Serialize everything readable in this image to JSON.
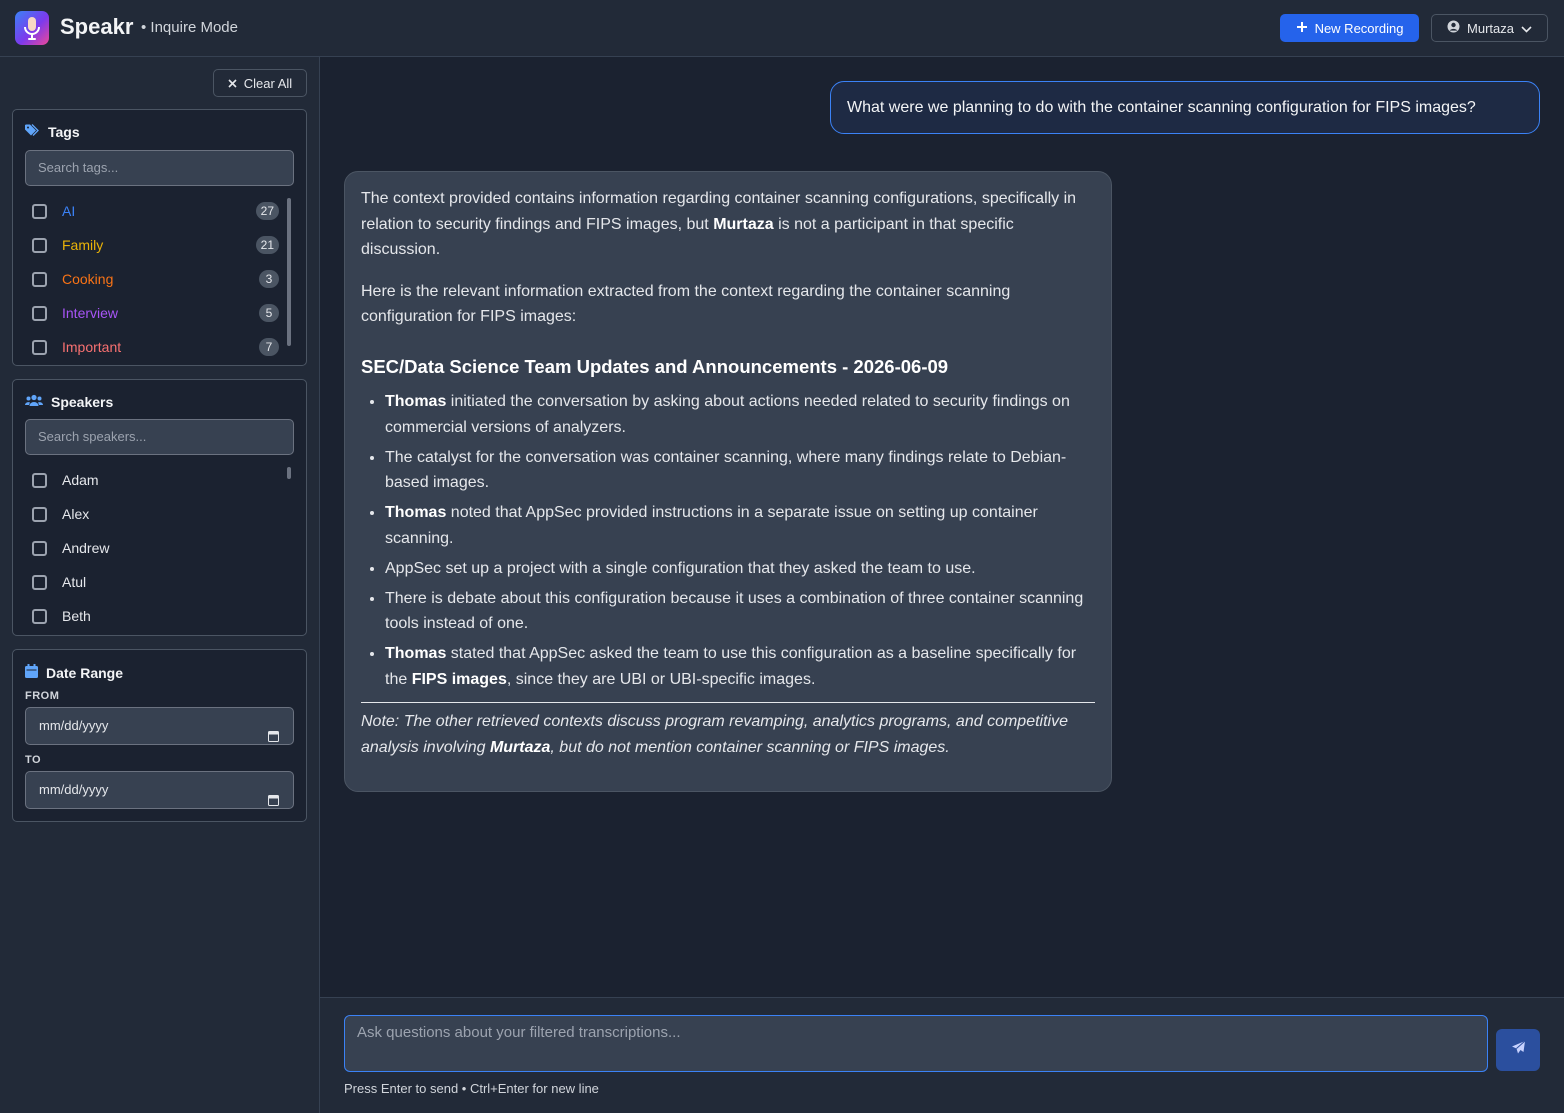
{
  "header": {
    "app_name": "Speakr",
    "mode": "• Inquire Mode",
    "new_recording": "New Recording",
    "user": "Murtaza"
  },
  "sidebar": {
    "clear_all": "Clear All",
    "tags": {
      "title": "Tags",
      "placeholder": "Search tags...",
      "items": [
        {
          "label": "AI",
          "count": "27",
          "color": "#3b82f6"
        },
        {
          "label": "Family",
          "count": "21",
          "color": "#eab308"
        },
        {
          "label": "Cooking",
          "count": "3",
          "color": "#f97316"
        },
        {
          "label": "Interview",
          "count": "5",
          "color": "#a855f7"
        },
        {
          "label": "Important",
          "count": "7",
          "color": "#f87171"
        }
      ]
    },
    "speakers": {
      "title": "Speakers",
      "placeholder": "Search speakers...",
      "items": [
        "Adam",
        "Alex",
        "Andrew",
        "Atul",
        "Beth"
      ]
    },
    "date_range": {
      "title": "Date Range",
      "from_label": "FROM",
      "to_label": "TO",
      "from_value": "mm/dd/yyyy",
      "to_value": "mm/dd/yyyy"
    }
  },
  "chat": {
    "user_question": "What were we planning to do with the container scanning configuration for FIPS images?",
    "answer": {
      "p1_a": "The context provided contains information regarding container scanning configurations, specifically in relation to security findings and FIPS images, but ",
      "p1_bold": "Murtaza",
      "p1_b": " is not a participant in that specific discussion.",
      "p2": "Here is the relevant information extracted from the context regarding the container scanning configuration for FIPS images:",
      "heading": "SEC/Data Science Team Updates and Announcements - 2026-06-09",
      "bullets": [
        {
          "bold": "Thomas",
          "text": " initiated the conversation by asking about actions needed related to security findings on commercial versions of analyzers."
        },
        {
          "bold": "",
          "text": "The catalyst for the conversation was container scanning, where many findings relate to Debian-based images."
        },
        {
          "bold": "Thomas",
          "text": " noted that AppSec provided instructions in a separate issue on setting up con­tainer scanning."
        },
        {
          "bold": "",
          "text": "AppSec set up a project with a single configuration that they asked the team to use."
        },
        {
          "bold": "",
          "text": "There is debate about this configuration because it uses a combination of three con­tainer scanning tools instead of one."
        }
      ],
      "last_bullet": {
        "bold1": "Thomas",
        "text1": " stated that AppSec asked the team to use this configuration as a baseline specifically for the ",
        "bold2": "FIPS images",
        "text2": ", since they are UBI or UBI-specific images."
      },
      "note_a": "Note: The other retrieved contexts discuss program revamping, analytics programs, and competitive analysis involving ",
      "note_bold": "Murtaza",
      "note_b": ", but do not mention container scanning or FIPS images."
    },
    "input_placeholder": "Ask questions about your filtered transcriptions...",
    "hint": "Press Enter to send • Ctrl+Enter for new line"
  }
}
